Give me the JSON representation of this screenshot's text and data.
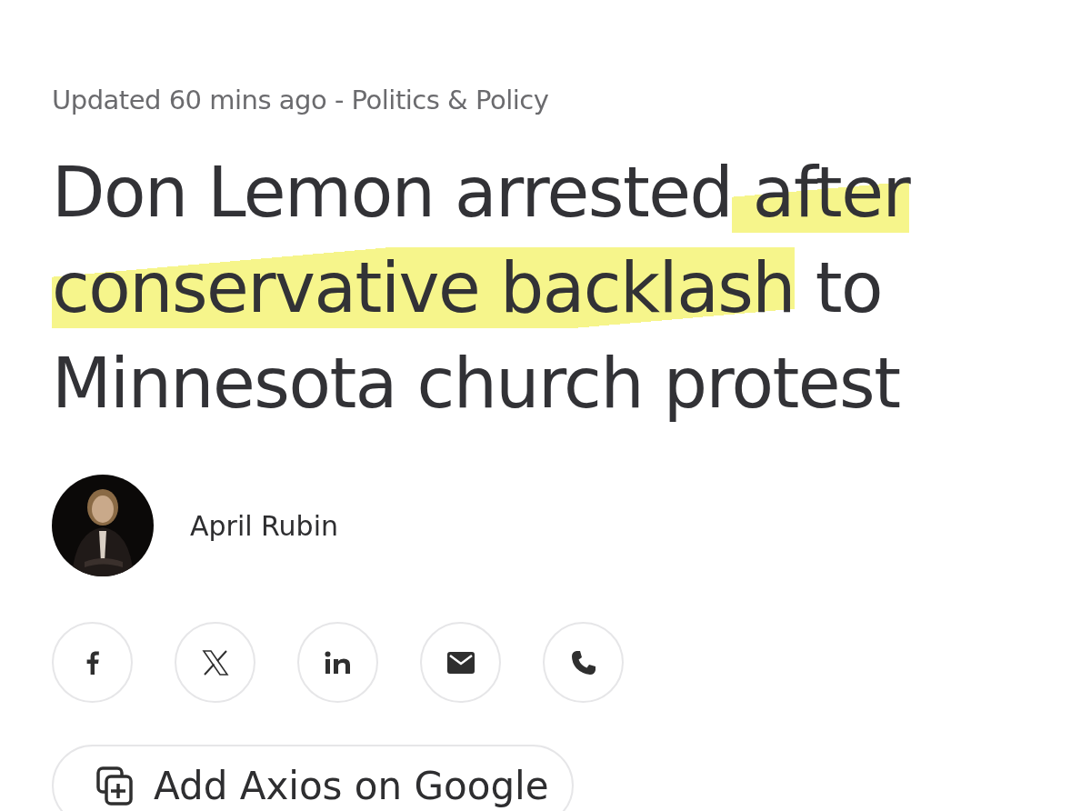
{
  "meta": "Updated 60 mins ago - Politics & Policy",
  "headline": [
    {
      "text": "Don Lemon arrested",
      "highlighted": false
    },
    {
      "text": " after conservative backlash",
      "highlighted": true
    },
    {
      "text": " to Minnesota church protest",
      "highlighted": false
    }
  ],
  "author": {
    "name": "April Rubin"
  },
  "share_buttons": [
    {
      "kind": "facebook"
    },
    {
      "kind": "x"
    },
    {
      "kind": "linkedin"
    },
    {
      "kind": "email"
    },
    {
      "kind": "phone"
    }
  ],
  "google_button": {
    "label": "Add Axios on Google"
  }
}
